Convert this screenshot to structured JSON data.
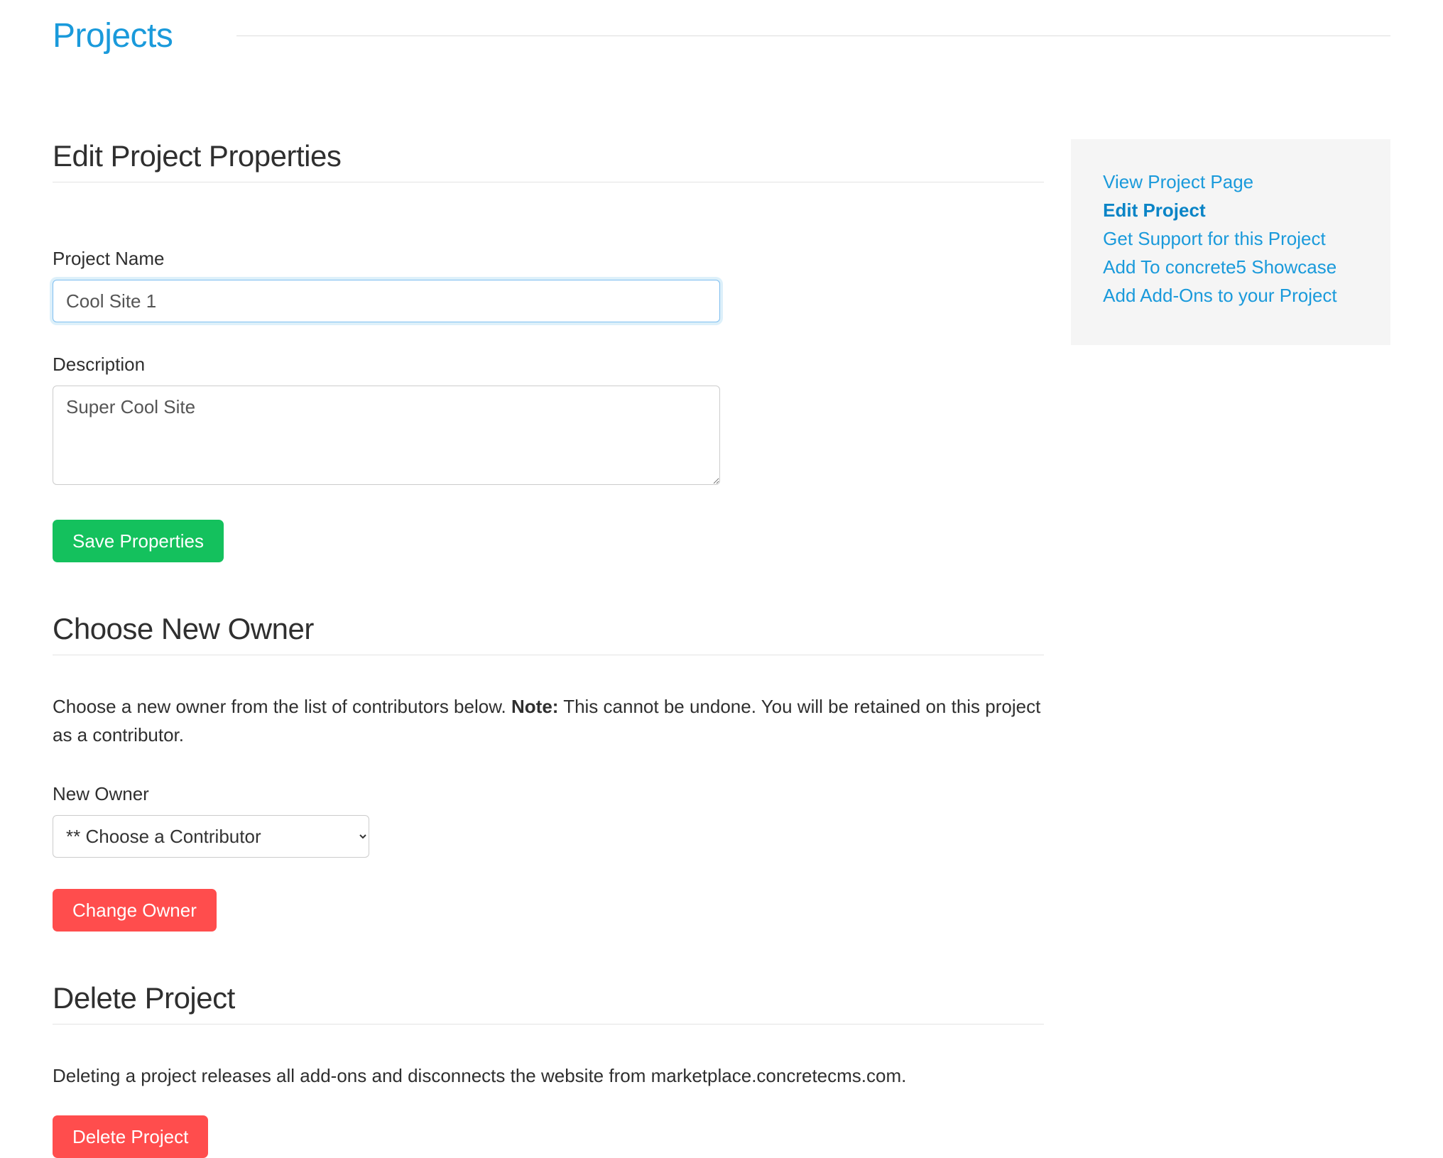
{
  "page": {
    "title": "Projects"
  },
  "sections": {
    "edit": {
      "heading": "Edit Project Properties",
      "project_name_label": "Project Name",
      "project_name_value": "Cool Site 1",
      "description_label": "Description",
      "description_value": "Super Cool Site",
      "save_button": "Save Properties"
    },
    "owner": {
      "heading": "Choose New Owner",
      "intro_pre": "Choose a new owner from the list of contributors below. ",
      "note_label": "Note:",
      "intro_post": " This cannot be undone. You will be retained on this project as a contributor.",
      "new_owner_label": "New Owner",
      "select_placeholder": "** Choose a Contributor",
      "change_button": "Change Owner"
    },
    "delete": {
      "heading": "Delete Project",
      "text": "Deleting a project releases all add-ons and disconnects the website from marketplace.concretecms.com.",
      "delete_button": "Delete Project"
    }
  },
  "sidebar": {
    "items": [
      {
        "label": "View Project Page",
        "active": false
      },
      {
        "label": "Edit Project",
        "active": true
      },
      {
        "label": "Get Support for this Project",
        "active": false
      },
      {
        "label": "Add To concrete5 Showcase",
        "active": false
      },
      {
        "label": "Add Add-Ons to your Project",
        "active": false
      }
    ]
  }
}
